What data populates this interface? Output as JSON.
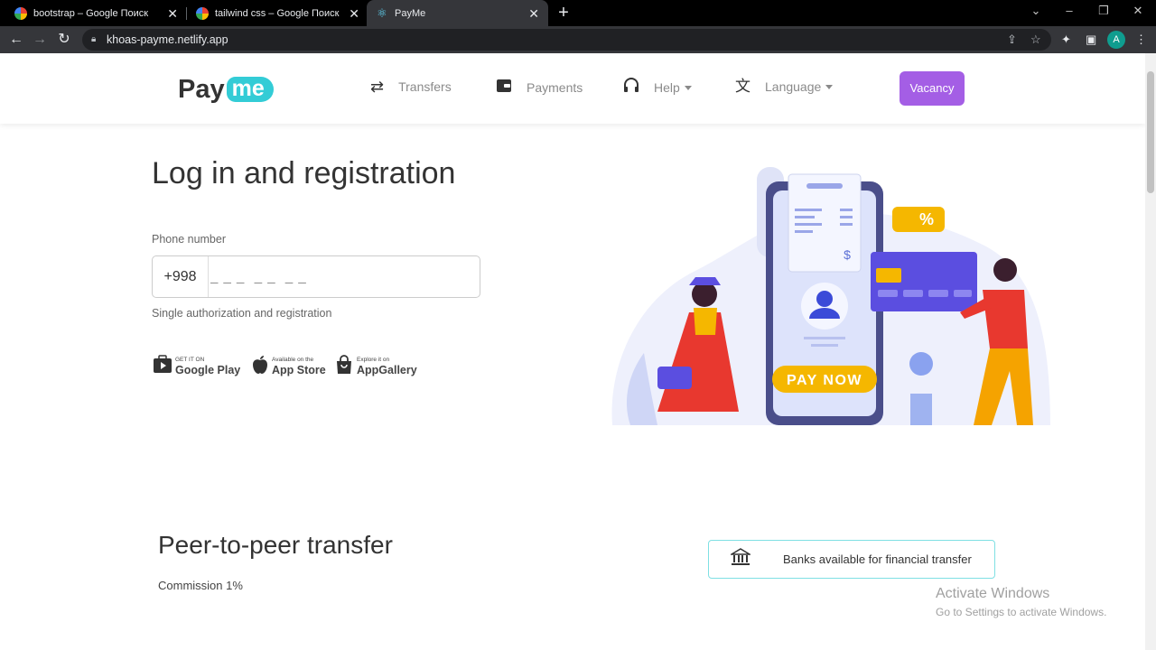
{
  "browser": {
    "tabs": [
      {
        "title": "bootstrap – Google Поиск",
        "favicon": "google-icon"
      },
      {
        "title": "tailwind css – Google Поиск",
        "favicon": "google-icon"
      },
      {
        "title": "PayMe",
        "favicon": "react-icon",
        "active": true
      }
    ],
    "url": "khoas-payme.netlify.app",
    "profile_initial": "A"
  },
  "header": {
    "logo": {
      "pay": "Pay",
      "me": "me"
    },
    "nav": [
      {
        "label": "Transfers",
        "icon": "transfer-arrows-icon"
      },
      {
        "label": "Payments",
        "icon": "wallet-icon"
      },
      {
        "label": "Help",
        "icon": "headphones-icon",
        "dropdown": true
      },
      {
        "label": "Language",
        "icon": "translate-icon",
        "dropdown": true
      }
    ],
    "vacancy_label": "Vacancy"
  },
  "login": {
    "title": "Log in and registration",
    "phone_label": "Phone number",
    "phone_prefix": "+998",
    "phone_placeholder": "_ _ _  _ _  _ _",
    "note": "Single authorization and registration"
  },
  "stores": [
    {
      "small": "GET IT ON",
      "big": "Google Play",
      "icon": "play-store-icon"
    },
    {
      "small": "Available on the",
      "big": "App Store",
      "icon": "apple-icon"
    },
    {
      "small": "Explore it on",
      "big": "AppGallery",
      "icon": "app-gallery-icon"
    }
  ],
  "illustration": {
    "pay_now": "PAY NOW",
    "percent": "%",
    "dollar": "$"
  },
  "p2p": {
    "title": "Peer-to-peer transfer",
    "commission": "Commission 1%",
    "banks_label": "Banks available for financial transfer"
  },
  "watermark": {
    "line1": "Activate Windows",
    "line2": "Go to Settings to activate Windows."
  },
  "colors": {
    "accent": "#a45ee5",
    "brand": "#33ccd6",
    "card": "#5b4ee0",
    "pay_now": "#f5b700"
  }
}
